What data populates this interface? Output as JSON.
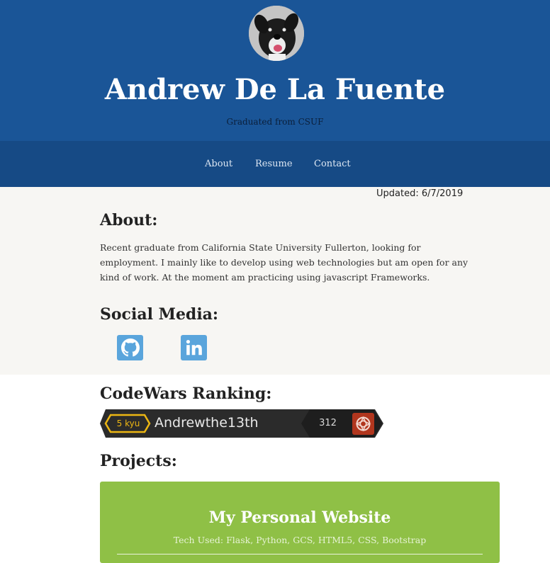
{
  "header": {
    "name": "Andrew De La Fuente",
    "subtitle": "Graduated from CSUF"
  },
  "nav": {
    "items": [
      "About",
      "Resume",
      "Contact"
    ]
  },
  "updated": "Updated: 6/7/2019",
  "about": {
    "heading": "About:",
    "text": "Recent graduate from California State University Fullerton, looking for employment. I mainly like to develop using web technologies but am open for any kind of work. At the moment am practicing using javascript Frameworks."
  },
  "social": {
    "heading": "Social Media:",
    "icons": [
      "github-icon",
      "linkedin-icon"
    ]
  },
  "codewars": {
    "heading": "CodeWars Ranking:",
    "kyu": "5 kyu",
    "username": "Andrewthe13th",
    "score": "312"
  },
  "projects": {
    "heading": "Projects:",
    "items": [
      {
        "title": "My Personal Website",
        "tech": "Tech Used: Flask, Python, GCS, HTML5, CSS, Bootstrap"
      }
    ]
  },
  "colors": {
    "header_bg": "#1a5597",
    "nav_bg": "#164a85",
    "about_bg": "#f7f6f3",
    "social_icon": "#5aa5dc",
    "codewars_dark": "#2b2b2b",
    "codewars_kyu": "#ecb613",
    "codewars_logo": "#b1361e",
    "project_card": "#8fc046"
  }
}
